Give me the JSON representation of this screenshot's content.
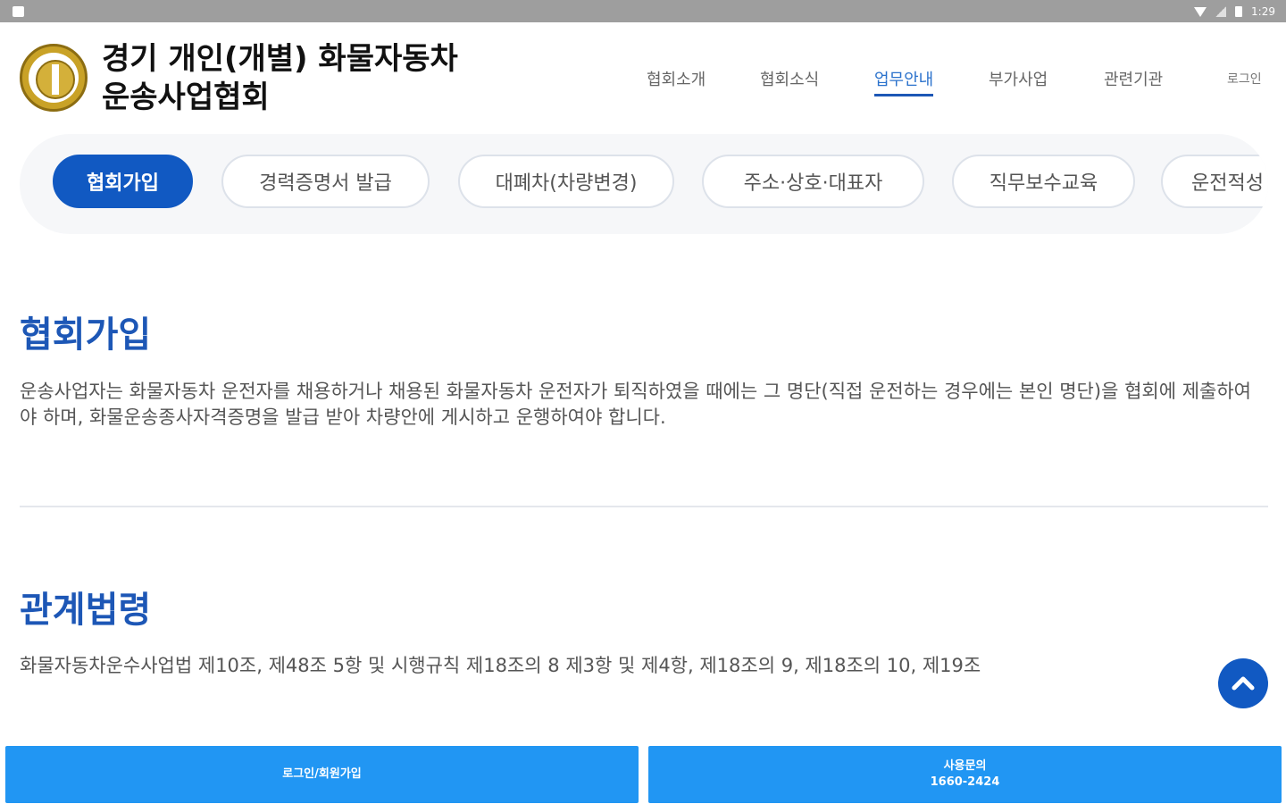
{
  "status_bar": {
    "time": "1:29"
  },
  "header": {
    "org_name_line1": "경기 개인(개별) 화물자동차",
    "org_name_line2": "운송사업협회",
    "nav": [
      {
        "label": "협회소개"
      },
      {
        "label": "협회소식"
      },
      {
        "label": "업무안내",
        "active": true
      },
      {
        "label": "부가사업"
      },
      {
        "label": "관련기관"
      }
    ],
    "login_label": "로그인"
  },
  "subnav": {
    "tabs": [
      {
        "label": "협회가입",
        "active": true
      },
      {
        "label": "경력증명서 발급"
      },
      {
        "label": "대폐차(차량변경)"
      },
      {
        "label": "주소·상호·대표자"
      },
      {
        "label": "직무보수교육"
      },
      {
        "label": "운전적성"
      }
    ]
  },
  "sections": [
    {
      "title": "협회가입",
      "body": "운송사업자는 화물자동차 운전자를 채용하거나 채용된 화물자동차 운전자가 퇴직하였을 때에는 그 명단(직접 운전하는 경우에는 본인 명단)을 협회에 제출하여야 하며, 화물운송종사자격증명을 발급 받아 차량안에 게시하고 운행하여야 합니다."
    },
    {
      "title": "관계법령",
      "body": "화물자동차운수사업법 제10조, 제48조 5항 및 시행규칙 제18조의 8 제3항 및 제4항, 제18조의 9, 제18조의 10, 제19조"
    }
  ],
  "bottom_bar": {
    "login_join_label": "로그인/회원가입",
    "inquiry_label": "사용문의",
    "inquiry_phone": "1660-2424"
  }
}
